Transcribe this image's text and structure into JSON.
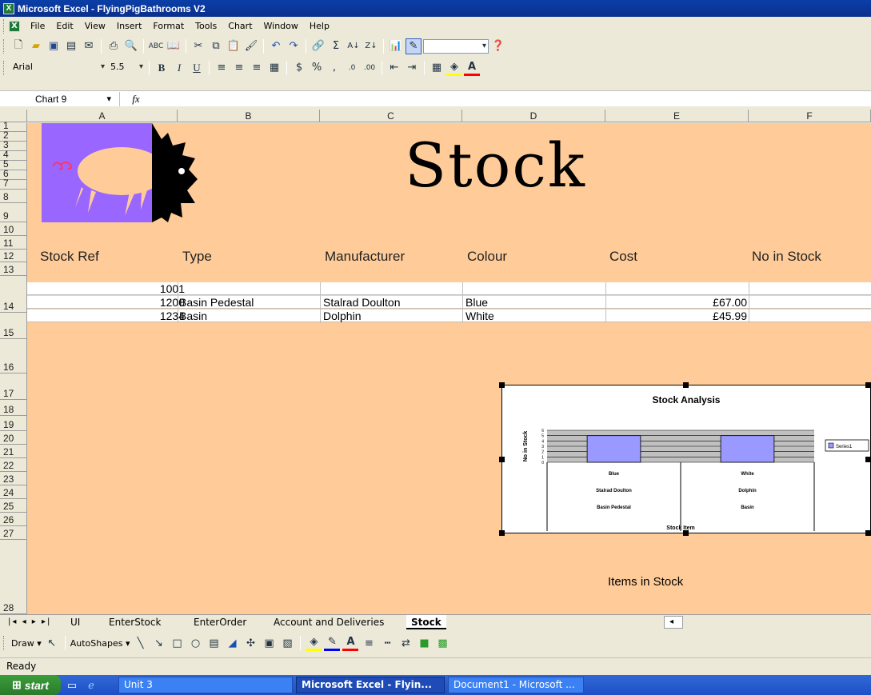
{
  "window": {
    "title": "Microsoft Excel - FlyingPigBathrooms V2"
  },
  "menu": [
    "File",
    "Edit",
    "View",
    "Insert",
    "Format",
    "Tools",
    "Chart",
    "Window",
    "Help"
  ],
  "format_toolbar": {
    "font": "Arial",
    "size": "5.5"
  },
  "formula_bar": {
    "name_box": "Chart 9",
    "fx": "fx",
    "formula": ""
  },
  "columns": [
    "A",
    "B",
    "C",
    "D",
    "E",
    "F"
  ],
  "rows": [
    "1",
    "2",
    "3",
    "4",
    "5",
    "6",
    "7",
    "8",
    "9",
    "10",
    "11",
    "12",
    "13",
    "14",
    "15",
    "16",
    "17",
    "18",
    "19",
    "20",
    "21",
    "22",
    "23",
    "24",
    "25",
    "26",
    "27",
    "28"
  ],
  "sheet": {
    "heading": "Stock",
    "headers": {
      "stock_ref": "Stock Ref",
      "type": "Type",
      "manufacturer": "Manufacturer",
      "colour": "Colour",
      "cost": "Cost",
      "no_in_stock": "No in Stock"
    },
    "records": [
      {
        "ref": "1001",
        "type": "",
        "manufacturer": "",
        "colour": "",
        "cost": ""
      },
      {
        "ref": "1200",
        "type": "Basin Pedestal",
        "manufacturer": "Stalrad Doulton",
        "colour": "Blue",
        "cost": "£67.00"
      },
      {
        "ref": "1234",
        "type": "Basin",
        "manufacturer": "Dolphin",
        "colour": "White",
        "cost": "£45.99"
      }
    ],
    "footer_label": "Items in Stock"
  },
  "chart_data": {
    "type": "bar",
    "title": "Stock Analysis",
    "xlabel": "Stock Item",
    "ylabel": "No in Stock",
    "categories": [
      [
        "Blue",
        "Stalrad Doulton",
        "Basin Pedestal"
      ],
      [
        "White",
        "Dolphin",
        "Basin"
      ]
    ],
    "series": [
      {
        "name": "Series1",
        "values": [
          5,
          5
        ]
      }
    ],
    "ylim": [
      0,
      6
    ],
    "yticks": [
      "0",
      "1",
      "2",
      "3",
      "4",
      "5",
      "6"
    ],
    "grid": true,
    "legend": "right",
    "colors": {
      "bar": "#9999ff",
      "plot_area": "#c0c0c0"
    }
  },
  "tabs": {
    "items": [
      "UI",
      "EnterStock",
      "EnterOrder",
      "Account and Deliveries",
      "Stock"
    ],
    "active": "Stock"
  },
  "drawbar": {
    "draw": "Draw ▾",
    "autoshapes": "AutoShapes ▾"
  },
  "status": {
    "text": "Ready"
  },
  "taskbar": {
    "start": "start",
    "items": [
      "Unit 3",
      "Microsoft Excel - Flyin...",
      "Document1 - Microsoft ..."
    ]
  },
  "colors": {
    "sheet_bg": "#ffcc99",
    "pig": "#9966ff",
    "title_bar": "#0a3fa8"
  }
}
